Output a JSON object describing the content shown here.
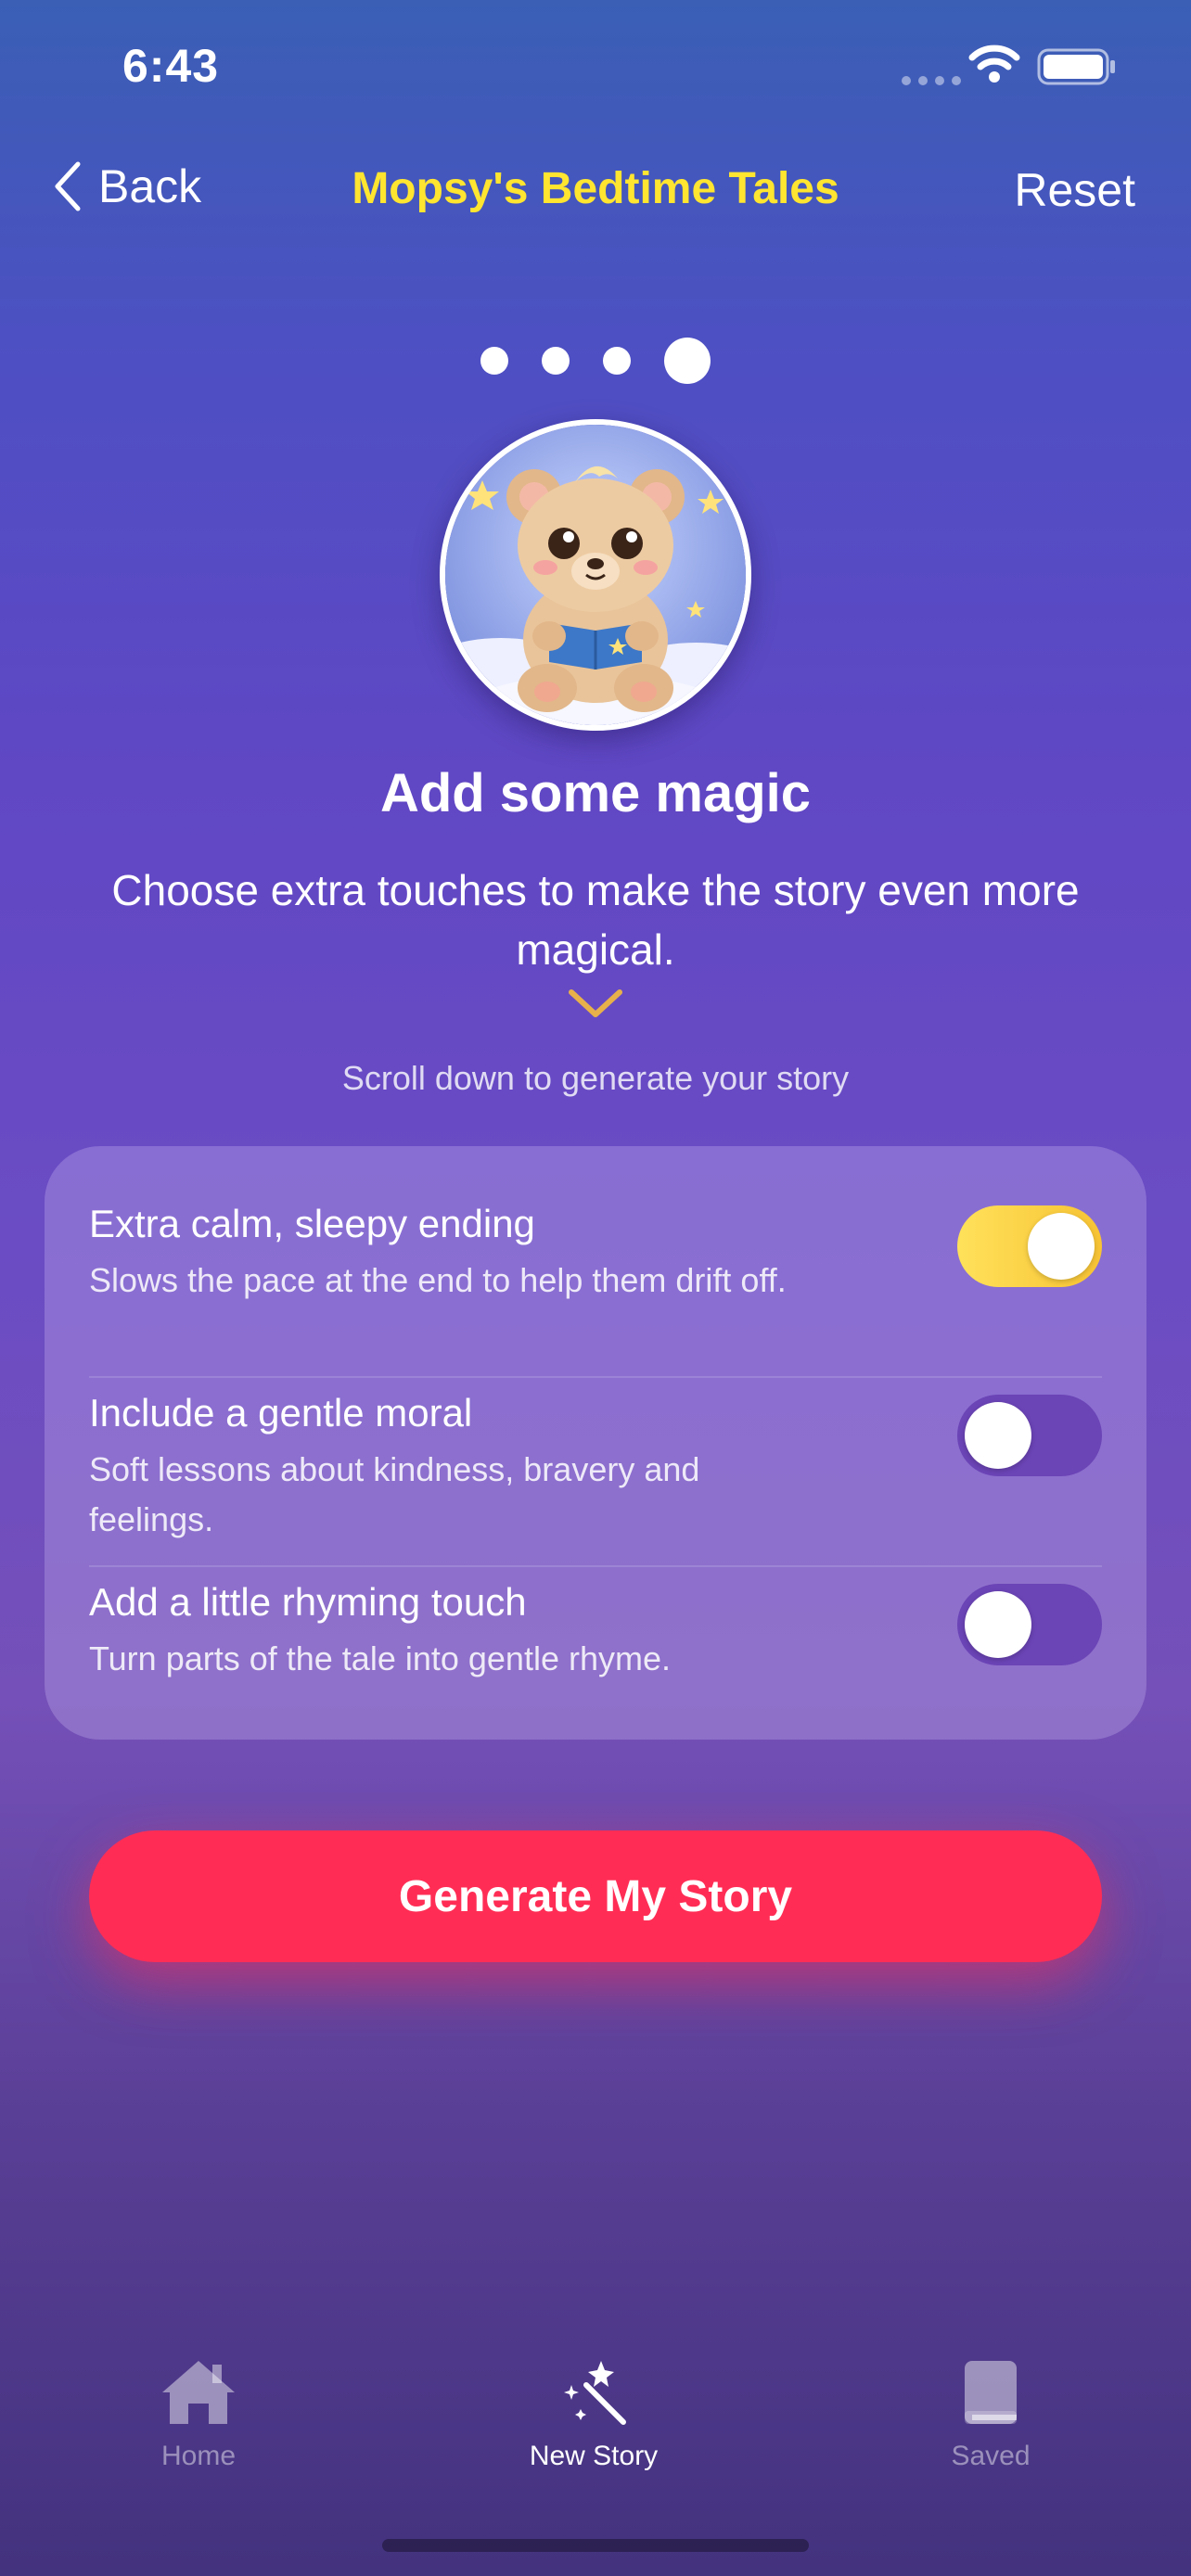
{
  "status_bar": {
    "time": "6:43"
  },
  "nav": {
    "back_label": "Back",
    "title": "Mopsy's Bedtime Tales",
    "reset_label": "Reset"
  },
  "progress": {
    "total_steps": 4,
    "current_step": 4
  },
  "avatar": {
    "icon": "teddy-bear-reading-illustration"
  },
  "main": {
    "heading": "Add some magic",
    "subtext": "Choose extra touches to make the story even more magical.",
    "scroll_hint": "Scroll down to generate your story"
  },
  "options": [
    {
      "title": "Extra calm, sleepy ending",
      "description": "Slows the pace at the end to help them drift off.",
      "enabled": true
    },
    {
      "title": "Include a gentle moral",
      "description": "Soft lessons about kindness, bravery and feelings.",
      "enabled": false
    },
    {
      "title": "Add a little rhyming touch",
      "description": "Turn parts of the tale into gentle rhyme.",
      "enabled": false
    }
  ],
  "generate_label": "Generate My Story",
  "tabs": [
    {
      "label": "Home",
      "icon": "house-icon",
      "active": false
    },
    {
      "label": "New Story",
      "icon": "magic-wand-icon",
      "active": true
    },
    {
      "label": "Saved",
      "icon": "book-icon",
      "active": false
    }
  ],
  "colors": {
    "title_yellow": "#ffe530",
    "toggle_on": "#f7c334",
    "toggle_off": "#6b44b6",
    "accent_button": "#ff2d55",
    "chevron": "#e8b14a"
  }
}
